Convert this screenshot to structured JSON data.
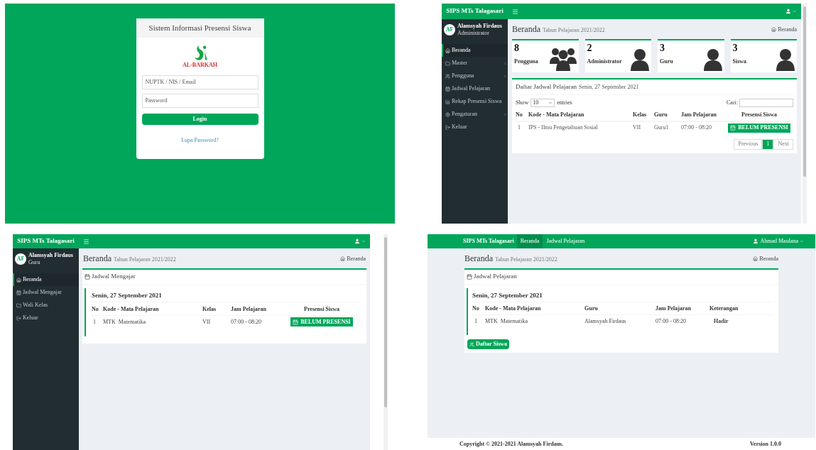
{
  "login": {
    "title": "Sistem Informasi Presensi Siswa",
    "logo_text": "AL-BARKAH",
    "fields": [
      {
        "placeholder": "NUPTK / NIS / Email"
      },
      {
        "placeholder": "Password"
      }
    ],
    "button": "Login",
    "link": "Lupa Password?"
  },
  "admin": {
    "brand": "SIPS MTs Talagasari",
    "user": {
      "initials": "AF",
      "name": "Alamsyah Firdaus",
      "role": "Administrator"
    },
    "menu": [
      {
        "label": "Beranda",
        "selected": true,
        "expandable": false
      },
      {
        "label": "Master",
        "selected": false,
        "expandable": true
      },
      {
        "label": "Pengguna",
        "selected": false,
        "expandable": true
      },
      {
        "label": "Jadwal Pelajaran",
        "selected": false,
        "expandable": false
      },
      {
        "label": "Rekap Presensi Siswa",
        "selected": false,
        "expandable": false
      },
      {
        "label": "Pengaturan",
        "selected": false,
        "expandable": true
      },
      {
        "label": "Keluar",
        "selected": false,
        "expandable": false
      }
    ],
    "header": {
      "title": "Beranda",
      "subtitle": "Tahun Pelajaran 2021/2022",
      "breadcrumb": "Beranda"
    },
    "stats": [
      {
        "value": "8",
        "label": "Pengguna",
        "kind": "group"
      },
      {
        "value": "2",
        "label": "Administrator",
        "kind": "user"
      },
      {
        "value": "3",
        "label": "Guru",
        "kind": "user"
      },
      {
        "value": "3",
        "label": "Siswa",
        "kind": "user"
      }
    ],
    "schedule": {
      "title": "Daftar Jadwal Pelajaran",
      "subtitle": "Senin, 27 September 2021",
      "show_label": "Show",
      "entries_value": "10",
      "entries_label": "entries",
      "search_label": "Cari:",
      "columns": [
        "No",
        "Kode - Mata Pelajaran",
        "Kelas",
        "Guru",
        "Jam Pelajaran",
        "Presensi Siswa"
      ],
      "rows": [
        {
          "no": "1",
          "subject": "IPS - Ilmu Pengetahuan Sosial",
          "class": "VII",
          "teacher": "Guru1",
          "time": "07:00 - 08:20",
          "action": "BELUM PRESENSI"
        }
      ],
      "pagination": [
        {
          "label": "Previous",
          "selected": false
        },
        {
          "label": "1",
          "selected": true
        },
        {
          "label": "Next",
          "selected": false
        }
      ]
    }
  },
  "teacher": {
    "brand": "SIPS MTs Talagasari",
    "user": {
      "initials": "AF",
      "name": "Alamsyah Firdaus",
      "role": "Guru"
    },
    "menu": [
      {
        "label": "Beranda",
        "selected": true,
        "expandable": false
      },
      {
        "label": "Jadwal Mengajar",
        "selected": false,
        "expandable": false
      },
      {
        "label": "Wali Kelas",
        "selected": false,
        "expandable": false
      },
      {
        "label": "Keluar",
        "selected": false,
        "expandable": false
      }
    ],
    "header": {
      "title": "Beranda",
      "subtitle": "Tahun Pelajaran 2021/2022",
      "breadcrumb": "Beranda"
    },
    "box_title": "Jadwal Mengajar",
    "date": "Senin, 27 September 2021",
    "columns": [
      "No",
      "Kode - Mata Pelajaran",
      "Kelas",
      "Jam Pelajaran",
      "Presensi Siswa"
    ],
    "rows": [
      {
        "no": "1",
        "code": "MTK",
        "subject": "Matematika",
        "class": "VII",
        "time": "07:00 - 08:20",
        "action": "BELUM PRESENSI"
      }
    ]
  },
  "student": {
    "brand": "SIPS MTs Talagasari",
    "nav": [
      {
        "label": "Beranda",
        "selected": true
      },
      {
        "label": "Jadwal Pelajaran",
        "selected": false
      }
    ],
    "user": "Ahmad Maulana",
    "header": {
      "title": "Beranda",
      "subtitle": "Tahun Pelajaran 2021/2022",
      "breadcrumb": "Beranda"
    },
    "box_title": "Jadwal Pelajaran",
    "date": "Senin, 27 September 2021",
    "columns": [
      "No",
      "Kode - Mata Pelajaran",
      "Guru",
      "Jam Pelajaran",
      "Keterangan"
    ],
    "rows": [
      {
        "no": "1",
        "code": "MTK",
        "subject": "Matematika",
        "teacher": "Alamsyah Firdaus",
        "time": "07:00 - 08:20",
        "status": "Hadir"
      }
    ],
    "button": "Daftar Siswa",
    "copyright": "Copyright © 2021-2021 Alamsyah Firdaus.",
    "version": "Version 1.0.0"
  }
}
